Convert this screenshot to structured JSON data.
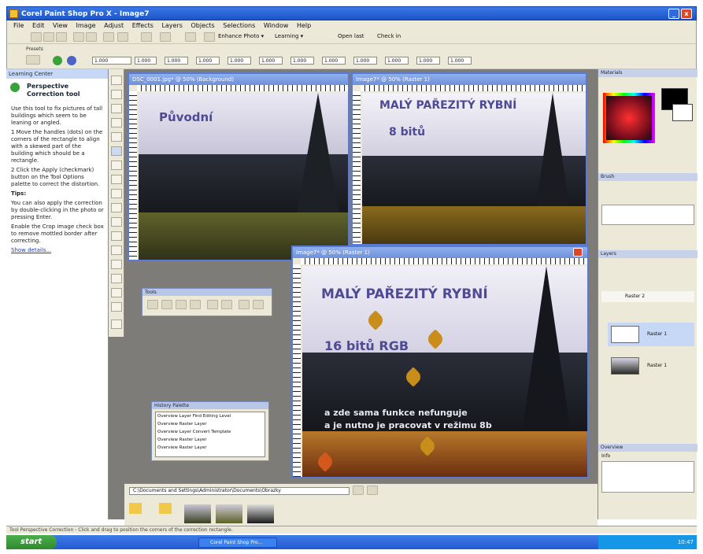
{
  "app": {
    "title": "Corel Paint Shop Pro X - Image7",
    "window_buttons": [
      "_",
      "□",
      "x"
    ]
  },
  "menu": [
    "File",
    "Edit",
    "View",
    "Image",
    "Adjust",
    "Effects",
    "Layers",
    "Objects",
    "Selections",
    "Window",
    "Help"
  ],
  "toolbar": {
    "enhance_photo": "Enhance Photo ▾",
    "learning": "Learning ▾",
    "open_last": "Open last",
    "check_in": "Check in"
  },
  "options": {
    "preset_label": "Presets",
    "fields": [
      "1.000",
      "1.000",
      "1.000",
      "1.000",
      "1.000",
      "1.000",
      "1.000",
      "1.000",
      "1.000",
      "1.000",
      "1.000",
      "1.000"
    ]
  },
  "learning_center": {
    "header": "Learning Center",
    "title": "Perspective Correction tool",
    "intro": "Use this tool to fix pictures of tall buildings which seem to be leaning or angled.",
    "steps": [
      "1 Move the handles (dots) on the corners of the rectangle to align with a skewed part of the building which should be a rectangle.",
      "2 Click the Apply (checkmark) button on the Tool Options palette to correct the distortion."
    ],
    "tips_label": "Tips:",
    "tips": [
      "You can also apply the correction by double-clicking in the photo or pressing Enter.",
      "Enable the Crop image check box to remove mottled border after correcting."
    ],
    "more": "Show details..."
  },
  "windows": {
    "original": {
      "title": "DSC_0001.jpg* @ 50% (Background)",
      "label": "Původní"
    },
    "eight_bit": {
      "title": "Image7* @ 50% (Raster 1)",
      "label1": "MALÝ PAŘEZITÝ RYBNÍ",
      "label2": "8 bitů"
    },
    "sixteen_bit": {
      "title": "Image7* @ 50% (Raster 1)",
      "label1": "MALÝ PAŘEZITÝ RYBNÍ",
      "label2": "16 bitů RGB",
      "note1": "a zde sama funkce nefunguje",
      "note2": "a je nutno je pracovat v režimu 8b"
    }
  },
  "palettes": {
    "mini_toolbar_title": "Tools",
    "history_title": "History Palette",
    "history_items": [
      "Overview Layer Find Editing Level",
      "Overview Raster Layer",
      "Overview Layer Convert Template",
      "Overview Raster Layer",
      "Overview Raster Layer"
    ]
  },
  "right_panels": {
    "materials": "Materials",
    "brush": "Brush",
    "layers": "Layers",
    "layer_items": [
      "Raster 2",
      "Raster 1",
      "Raster 1"
    ],
    "overview": "Overview",
    "info": "Info"
  },
  "browser": {
    "path": "C:\\Documents and Settings\\Administrator\\Documents\\Obrazky"
  },
  "statusbar": "Tool Perspective Correction - Click and drag to position the corners of the correction rectangle.",
  "taskbar": {
    "start": "start",
    "task": "Corel Paint Shop Pro...",
    "time": "10:47"
  },
  "colors": {
    "title_blue": "#1d54c8",
    "chrome": "#ece9d8",
    "workspace": "#7d7c79",
    "image_text": "#4e4a94",
    "note_text": "#e8e8f0"
  }
}
